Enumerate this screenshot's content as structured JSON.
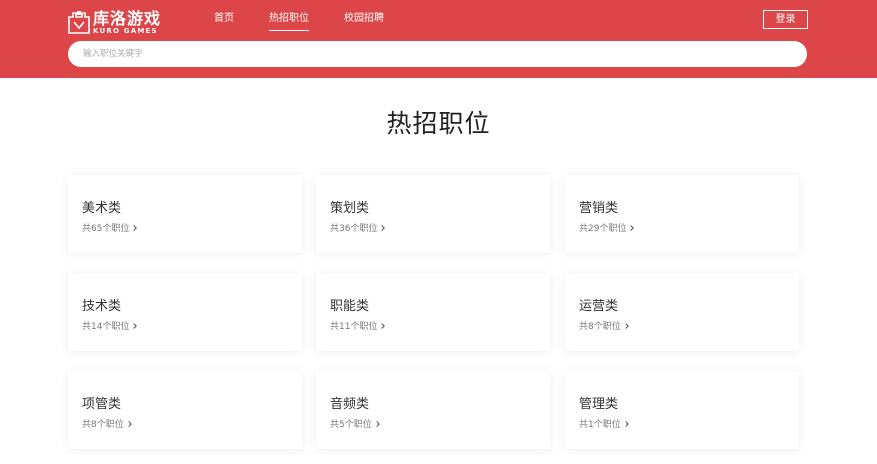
{
  "header": {
    "logo_title": "库洛游戏",
    "logo_subtitle": "KURO GAMES",
    "login_label": "登录",
    "nav": [
      {
        "label": "首页"
      },
      {
        "label": "热招职位"
      },
      {
        "label": "校园招聘"
      }
    ],
    "active_nav": "热招职位",
    "colors": {
      "brand": "#dc4649"
    }
  },
  "search": {
    "placeholder": "输入职位关键字",
    "value": ""
  },
  "main": {
    "title": "热招职位",
    "categories": [
      {
        "name": "美术类",
        "count": "共65个职位"
      },
      {
        "name": "策划类",
        "count": "共36个职位"
      },
      {
        "name": "营销类",
        "count": "共29个职位"
      },
      {
        "name": "技术类",
        "count": "共14个职位"
      },
      {
        "name": "职能类",
        "count": "共11个职位"
      },
      {
        "name": "运营类",
        "count": "共8个职位"
      },
      {
        "name": "项管类",
        "count": "共8个职位"
      },
      {
        "name": "音频类",
        "count": "共5个职位"
      },
      {
        "name": "管理类",
        "count": "共1个职位"
      }
    ]
  }
}
